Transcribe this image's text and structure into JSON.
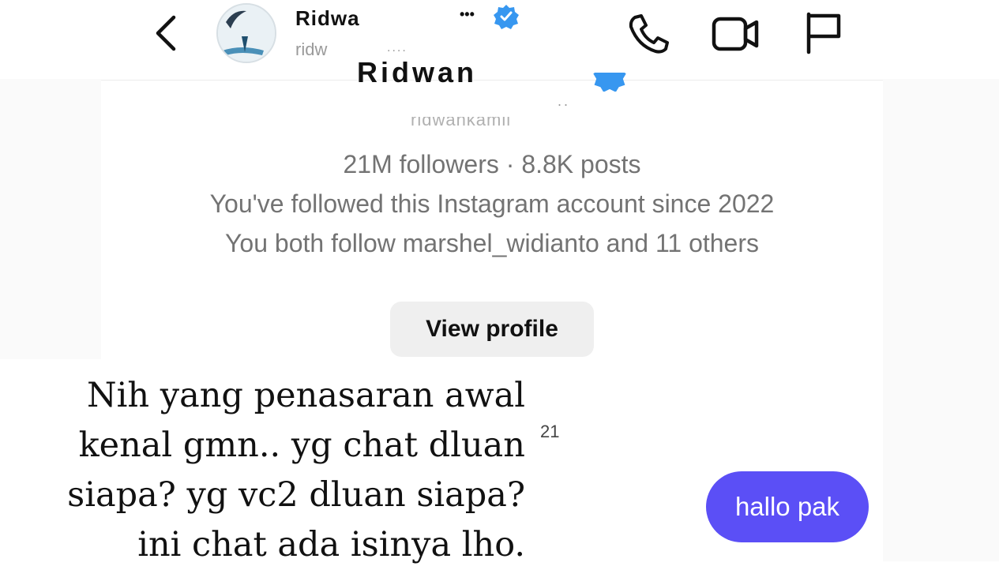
{
  "header": {
    "name": "Ridwa",
    "name_tail": "•••",
    "username": "ridw",
    "username_tail": "....",
    "back_icon": "chevron-left-icon",
    "avatar_icon": "avatar-image",
    "verified_icon": "verified-badge-icon",
    "actions": [
      {
        "name": "phone-call-button",
        "icon": "phone-icon"
      },
      {
        "name": "video-call-button",
        "icon": "video-camera-icon"
      },
      {
        "name": "report-button",
        "icon": "flag-icon"
      }
    ]
  },
  "profile": {
    "name_cut": "Ridwan",
    "dots": "..",
    "username_cut": "ridwankamil",
    "stats_line": "21M followers · 8.8K posts",
    "followed_since": "You've followed this Instagram account since 2022",
    "mutuals": "You both follow marshel_widianto and 11 others",
    "view_profile_label": "View profile"
  },
  "caption": {
    "lines": [
      "Nih yang penasaran awal",
      "kenal gmn.. yg chat dluan",
      "siapa? yg vc2 dluan siapa?",
      "ini chat ada isinya lho."
    ],
    "badge": "21"
  },
  "messages": [
    {
      "text": "hallo pak",
      "sender": "me",
      "color": "#5b4ff6"
    }
  ],
  "colors": {
    "accent": "#5b4ff6",
    "verified": "#3797f0",
    "secondary_text": "#737373",
    "button_bg": "#efefef"
  }
}
